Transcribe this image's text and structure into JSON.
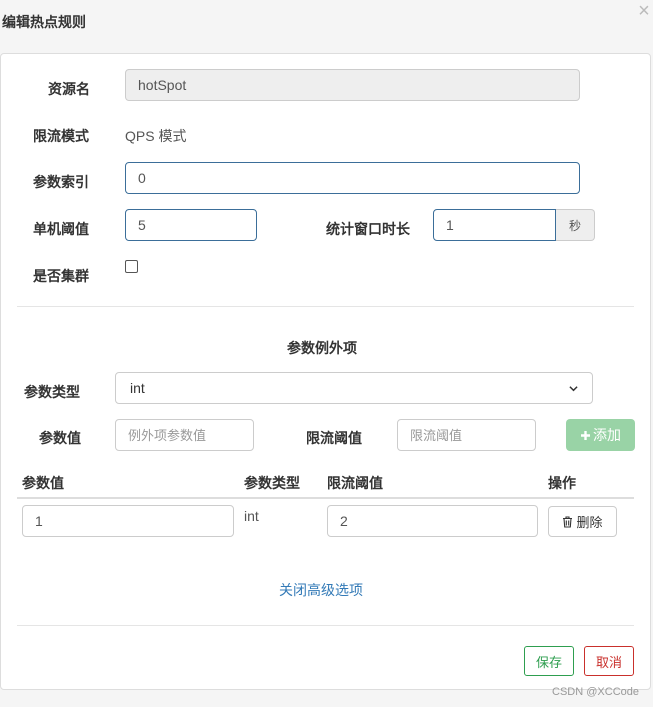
{
  "dialog": {
    "title": "编辑热点规则",
    "close": "×"
  },
  "form": {
    "resource": {
      "label": "资源名",
      "value": "hotSpot"
    },
    "limit_mode": {
      "label": "限流模式",
      "value": "QPS 模式"
    },
    "param_index": {
      "label": "参数索引",
      "value": "0"
    },
    "threshold": {
      "label": "单机阈值",
      "value": "5"
    },
    "window": {
      "label": "统计窗口时长",
      "value": "1",
      "unit": "秒"
    },
    "cluster": {
      "label": "是否集群",
      "checked": false
    }
  },
  "exceptions": {
    "section_title": "参数例外项",
    "param_type": {
      "label": "参数类型",
      "selected": "int"
    },
    "param_value": {
      "label": "参数值",
      "placeholder": "例外项参数值"
    },
    "limit_threshold": {
      "label": "限流阈值",
      "placeholder": "限流阈值"
    },
    "add_button": "添加"
  },
  "table": {
    "headers": [
      "参数值",
      "参数类型",
      "限流阈值",
      "操作"
    ],
    "rows": [
      {
        "param_value": "1",
        "param_type": "int",
        "threshold": "2",
        "action": "删除"
      }
    ]
  },
  "toggle_advanced": "关闭高级选项",
  "footer": {
    "save": "保存",
    "cancel": "取消"
  },
  "watermark": "CSDN @XCCode"
}
